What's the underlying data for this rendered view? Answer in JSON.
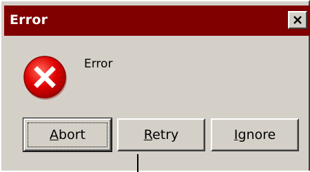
{
  "window": {
    "title": "Error",
    "close_icon": "close-icon"
  },
  "content": {
    "icon": "error-icon",
    "message": "Error"
  },
  "buttons": [
    {
      "label_mnemonic": "A",
      "label_rest": "bort",
      "label": "Abort",
      "default": true
    },
    {
      "label_mnemonic": "R",
      "label_rest": "etry",
      "label": "Retry",
      "default": false
    },
    {
      "label_mnemonic": "I",
      "label_rest": "gnore",
      "label": "Ignore",
      "default": false
    }
  ],
  "colors": {
    "titlebar": "#800000",
    "dialog_bg": "#d4d0c8",
    "error_icon_red": "#d40000"
  }
}
